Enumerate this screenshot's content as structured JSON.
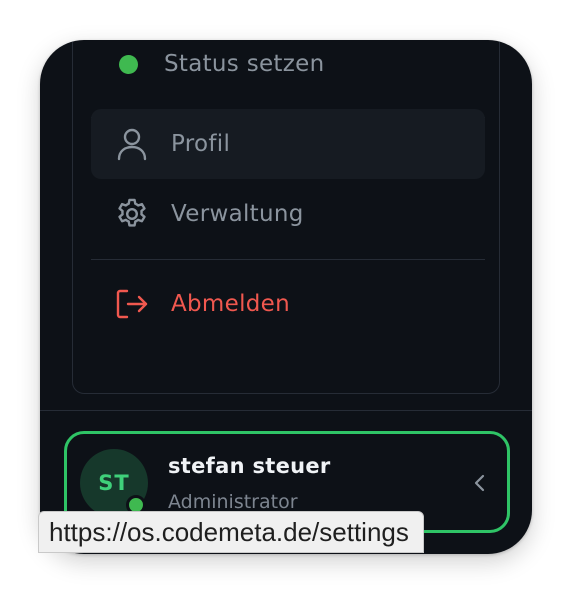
{
  "menu": {
    "items": [
      {
        "label": "Status setzen",
        "icon": "status-dot"
      },
      {
        "label": "Profil",
        "icon": "user-icon"
      },
      {
        "label": "Verwaltung",
        "icon": "gear-icon"
      },
      {
        "label": "Abmelden",
        "icon": "logout-icon"
      }
    ]
  },
  "user": {
    "initials": "ST",
    "name": "stefan steuer",
    "role": "Administrator",
    "presence": "online"
  },
  "tooltip": {
    "url": "https://os.codemeta.de/settings"
  },
  "colors": {
    "panel_bg": "#0d1117",
    "accent_green": "#2fc466",
    "logout_red": "#f0584f",
    "muted_text": "#8b949e"
  }
}
